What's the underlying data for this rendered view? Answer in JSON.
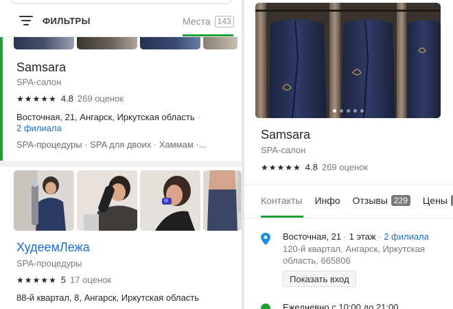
{
  "filter_bar": {
    "filters_label": "ФИЛЬТРЫ",
    "places_label": "Места",
    "places_count": "143"
  },
  "results": [
    {
      "title": "Samsara",
      "category": "SPA-салон",
      "stars": "★★★★★",
      "rating": "4.8",
      "reviews": "269 оценок",
      "address": "Восточная, 21, Ангарск, Иркутская область",
      "address_sep": "·",
      "branches": "2 филиала",
      "tags": "SPA-процедуры · SPA для двоих · Хаммам ·..."
    },
    {
      "title": "ХудеемЛежа",
      "category": "SPA-процедуры",
      "stars": "★★★★★",
      "rating": "5",
      "reviews": "17 оценок",
      "address": "88-й квартал, 8, Ангарск, Иркутская область"
    }
  ],
  "detail": {
    "title": "Samsara",
    "category": "SPA-салон",
    "stars": "★★★★★",
    "rating": "4.8",
    "reviews": "269 оценок",
    "tabs": {
      "contacts": "Контакты",
      "info": "Инфо",
      "reviews": "Отзывы",
      "reviews_count": "229",
      "prices": "Цены"
    },
    "address_street": "Восточная, 21",
    "address_floor": "1 этаж",
    "address_branches": "2 филиала",
    "address_sep": "·",
    "address_detail": "120-й квартал, Ангарск, Иркутская область, 665806",
    "entrance_button": "Показать вход",
    "hours": "Ежедневно с 10:00 до 21:00"
  },
  "icons": {
    "filter": "filter-icon",
    "pin": "location-pin-icon",
    "clock": "clock-icon"
  },
  "colors": {
    "accent_green": "#1ba136",
    "link_blue": "#1e6ec8",
    "pin_blue": "#1a8fdd"
  }
}
